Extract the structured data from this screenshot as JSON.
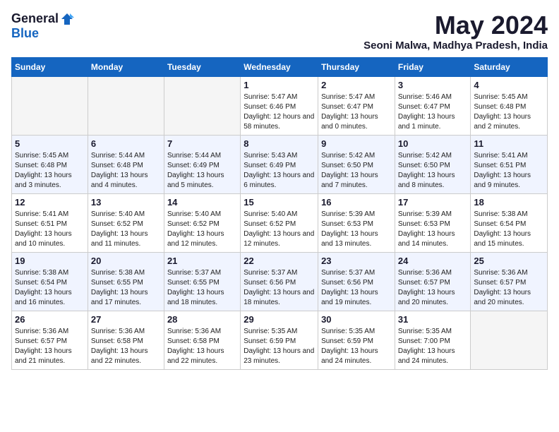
{
  "logo": {
    "general": "General",
    "blue": "Blue"
  },
  "title": "May 2024",
  "location": "Seoni Malwa, Madhya Pradesh, India",
  "headers": [
    "Sunday",
    "Monday",
    "Tuesday",
    "Wednesday",
    "Thursday",
    "Friday",
    "Saturday"
  ],
  "weeks": [
    [
      {
        "num": "",
        "info": ""
      },
      {
        "num": "",
        "info": ""
      },
      {
        "num": "",
        "info": ""
      },
      {
        "num": "1",
        "info": "Sunrise: 5:47 AM\nSunset: 6:46 PM\nDaylight: 12 hours and 58 minutes."
      },
      {
        "num": "2",
        "info": "Sunrise: 5:47 AM\nSunset: 6:47 PM\nDaylight: 13 hours and 0 minutes."
      },
      {
        "num": "3",
        "info": "Sunrise: 5:46 AM\nSunset: 6:47 PM\nDaylight: 13 hours and 1 minute."
      },
      {
        "num": "4",
        "info": "Sunrise: 5:45 AM\nSunset: 6:48 PM\nDaylight: 13 hours and 2 minutes."
      }
    ],
    [
      {
        "num": "5",
        "info": "Sunrise: 5:45 AM\nSunset: 6:48 PM\nDaylight: 13 hours and 3 minutes."
      },
      {
        "num": "6",
        "info": "Sunrise: 5:44 AM\nSunset: 6:48 PM\nDaylight: 13 hours and 4 minutes."
      },
      {
        "num": "7",
        "info": "Sunrise: 5:44 AM\nSunset: 6:49 PM\nDaylight: 13 hours and 5 minutes."
      },
      {
        "num": "8",
        "info": "Sunrise: 5:43 AM\nSunset: 6:49 PM\nDaylight: 13 hours and 6 minutes."
      },
      {
        "num": "9",
        "info": "Sunrise: 5:42 AM\nSunset: 6:50 PM\nDaylight: 13 hours and 7 minutes."
      },
      {
        "num": "10",
        "info": "Sunrise: 5:42 AM\nSunset: 6:50 PM\nDaylight: 13 hours and 8 minutes."
      },
      {
        "num": "11",
        "info": "Sunrise: 5:41 AM\nSunset: 6:51 PM\nDaylight: 13 hours and 9 minutes."
      }
    ],
    [
      {
        "num": "12",
        "info": "Sunrise: 5:41 AM\nSunset: 6:51 PM\nDaylight: 13 hours and 10 minutes."
      },
      {
        "num": "13",
        "info": "Sunrise: 5:40 AM\nSunset: 6:52 PM\nDaylight: 13 hours and 11 minutes."
      },
      {
        "num": "14",
        "info": "Sunrise: 5:40 AM\nSunset: 6:52 PM\nDaylight: 13 hours and 12 minutes."
      },
      {
        "num": "15",
        "info": "Sunrise: 5:40 AM\nSunset: 6:52 PM\nDaylight: 13 hours and 12 minutes."
      },
      {
        "num": "16",
        "info": "Sunrise: 5:39 AM\nSunset: 6:53 PM\nDaylight: 13 hours and 13 minutes."
      },
      {
        "num": "17",
        "info": "Sunrise: 5:39 AM\nSunset: 6:53 PM\nDaylight: 13 hours and 14 minutes."
      },
      {
        "num": "18",
        "info": "Sunrise: 5:38 AM\nSunset: 6:54 PM\nDaylight: 13 hours and 15 minutes."
      }
    ],
    [
      {
        "num": "19",
        "info": "Sunrise: 5:38 AM\nSunset: 6:54 PM\nDaylight: 13 hours and 16 minutes."
      },
      {
        "num": "20",
        "info": "Sunrise: 5:38 AM\nSunset: 6:55 PM\nDaylight: 13 hours and 17 minutes."
      },
      {
        "num": "21",
        "info": "Sunrise: 5:37 AM\nSunset: 6:55 PM\nDaylight: 13 hours and 18 minutes."
      },
      {
        "num": "22",
        "info": "Sunrise: 5:37 AM\nSunset: 6:56 PM\nDaylight: 13 hours and 18 minutes."
      },
      {
        "num": "23",
        "info": "Sunrise: 5:37 AM\nSunset: 6:56 PM\nDaylight: 13 hours and 19 minutes."
      },
      {
        "num": "24",
        "info": "Sunrise: 5:36 AM\nSunset: 6:57 PM\nDaylight: 13 hours and 20 minutes."
      },
      {
        "num": "25",
        "info": "Sunrise: 5:36 AM\nSunset: 6:57 PM\nDaylight: 13 hours and 20 minutes."
      }
    ],
    [
      {
        "num": "26",
        "info": "Sunrise: 5:36 AM\nSunset: 6:57 PM\nDaylight: 13 hours and 21 minutes."
      },
      {
        "num": "27",
        "info": "Sunrise: 5:36 AM\nSunset: 6:58 PM\nDaylight: 13 hours and 22 minutes."
      },
      {
        "num": "28",
        "info": "Sunrise: 5:36 AM\nSunset: 6:58 PM\nDaylight: 13 hours and 22 minutes."
      },
      {
        "num": "29",
        "info": "Sunrise: 5:35 AM\nSunset: 6:59 PM\nDaylight: 13 hours and 23 minutes."
      },
      {
        "num": "30",
        "info": "Sunrise: 5:35 AM\nSunset: 6:59 PM\nDaylight: 13 hours and 24 minutes."
      },
      {
        "num": "31",
        "info": "Sunrise: 5:35 AM\nSunset: 7:00 PM\nDaylight: 13 hours and 24 minutes."
      },
      {
        "num": "",
        "info": ""
      }
    ]
  ]
}
